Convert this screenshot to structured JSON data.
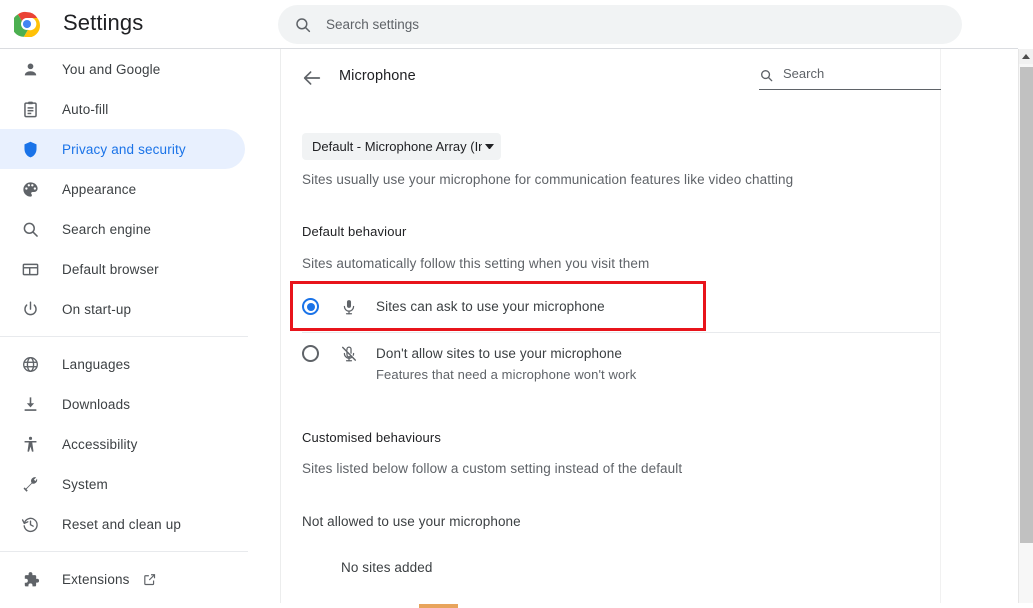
{
  "topbar": {
    "app_title": "Settings",
    "logo_icon": "chrome-logo-icon",
    "search_icon": "search-icon",
    "search_placeholder": "Search settings",
    "search_value": ""
  },
  "sidebar": {
    "groups": [
      {
        "items": [
          {
            "label": "You and Google",
            "icon": "person-icon",
            "active": false
          },
          {
            "label": "Auto-fill",
            "icon": "clipboard-icon",
            "active": false
          },
          {
            "label": "Privacy and security",
            "icon": "shield-icon",
            "active": true
          },
          {
            "label": "Appearance",
            "icon": "palette-icon",
            "active": false
          },
          {
            "label": "Search engine",
            "icon": "search-icon",
            "active": false
          },
          {
            "label": "Default browser",
            "icon": "browser-window-icon",
            "active": false
          },
          {
            "label": "On start-up",
            "icon": "power-icon",
            "active": false
          }
        ]
      },
      {
        "items": [
          {
            "label": "Languages",
            "icon": "globe-icon",
            "active": false
          },
          {
            "label": "Downloads",
            "icon": "download-icon",
            "active": false
          },
          {
            "label": "Accessibility",
            "icon": "accessibility-icon",
            "active": false
          },
          {
            "label": "System",
            "icon": "wrench-icon",
            "active": false
          },
          {
            "label": "Reset and clean up",
            "icon": "history-restore-icon",
            "active": false
          }
        ]
      },
      {
        "items": [
          {
            "label": "Extensions",
            "icon": "puzzle-piece-icon",
            "active": false,
            "external": true,
            "external_icon": "external-link-icon"
          }
        ]
      }
    ]
  },
  "main": {
    "back_icon": "back-arrow-icon",
    "page_title": "Microphone",
    "sub_search": {
      "icon": "search-icon",
      "placeholder": "Search",
      "value": ""
    },
    "device_select": {
      "value": "Default - Microphone Array (In",
      "caret_icon": "chevron-down-icon"
    },
    "intro_text": "Sites usually use your microphone for communication features like video chatting",
    "default_behaviour": {
      "heading": "Default behaviour",
      "description": "Sites automatically follow this setting when you visit them",
      "options": [
        {
          "title": "Sites can ask to use your microphone",
          "subtitle": "",
          "icon": "microphone-icon",
          "selected": true,
          "highlighted": true
        },
        {
          "title": "Don't allow sites to use your microphone",
          "subtitle": "Features that need a microphone won't work",
          "icon": "microphone-off-icon",
          "selected": false,
          "highlighted": false
        }
      ]
    },
    "customised_behaviours": {
      "heading": "Customised behaviours",
      "description": "Sites listed below follow a custom setting instead of the default",
      "blocked_heading": "Not allowed to use your microphone",
      "empty_text": "No sites added"
    }
  },
  "scrollbar": {
    "up_icon": "scroll-up-arrow-icon"
  },
  "colors": {
    "accent_blue": "#1a73e8",
    "active_nav_bg": "#e8f0fe",
    "annotation_red": "#e8141b",
    "text_primary": "#202124",
    "text_secondary": "#5f6368",
    "chip_orange": "#e8a45c"
  }
}
